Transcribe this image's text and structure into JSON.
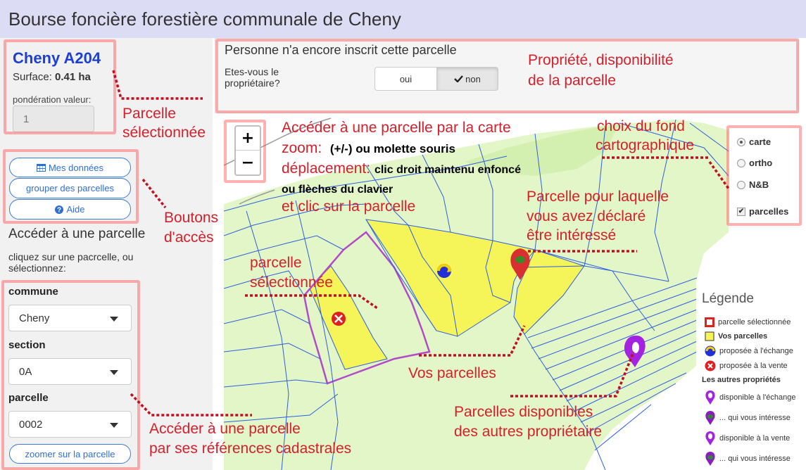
{
  "header": {
    "title": "Bourse foncière forestière communale de Cheny"
  },
  "parcel": {
    "name": "Cheny A204",
    "surface_label": "Surface: ",
    "surface_value": "0.41 ha",
    "ponderation_label": "pondération valeur:",
    "ponderation_value": "1"
  },
  "buttons": {
    "mes_donnees": "Mes données",
    "grouper": "grouper des parcelles",
    "aide": "Aide",
    "zoomer": "zoomer sur la parcelle"
  },
  "access": {
    "title": "Accéder à une parcelle",
    "hint": "cliquez sur une pacrcelle, ou sélectionnez:",
    "commune_label": "commune",
    "commune_value": "Cheny",
    "section_label": "section",
    "section_value": "0A",
    "parcelle_label": "parcelle",
    "parcelle_value": "0002"
  },
  "property": {
    "status": "Personne n'a encore inscrit cette parcelle",
    "question": "Etes-vous le propriétaire?",
    "oui": "oui",
    "non": "non"
  },
  "map": {
    "zoom_in": "+",
    "zoom_out": "−",
    "layers": {
      "carte": "carte",
      "ortho": "ortho",
      "nb": "N&B",
      "parcelles": "parcelles",
      "selected": "carte",
      "parcelles_checked": true
    },
    "legend": {
      "title": "Légende",
      "selected": "parcelle sélectionnée",
      "vos": "Vos parcelles",
      "echange": "proposée à l'échange",
      "vente": "proposée à la vente",
      "autres": "Les autres propriétés",
      "dispo_echange": "disponible à l'échange",
      "interesse1": "... qui vous intéresse",
      "dispo_vente": "disponible à la vente",
      "interesse2": "... qui vous intéresse"
    }
  },
  "annotations": {
    "propriete_1": "Propriété, disponibilité",
    "propriete_2": "de la parcelle",
    "parcelle_sel_1": "Parcelle",
    "parcelle_sel_2": "sélectionnée",
    "acceder_carte_1": "Accéder à une parcelle par la carte",
    "zoom_label": "zoom:",
    "zoom_text": "(+/-) ou molette souris",
    "deplacement_label": "déplacement:",
    "deplacement_text": "clic droit maintenu enfoncé",
    "fleches_text": "ou flèches du clavier",
    "clic_parcelle": "et clic sur la parcelle",
    "fond_1": "choix du fond",
    "fond_2": "cartographique",
    "interesse_1": "Parcelle pour laquelle",
    "interesse_2": "vous avez déclaré",
    "interesse_3": "être intéressé",
    "boutons_1": "Boutons",
    "boutons_2": "d'accès",
    "map_sel_1": "parcelle",
    "map_sel_2": "sélectionnée",
    "vos_parcelles": "Vos parcelles",
    "dispo_1": "Parcelles disponibles",
    "dispo_2": "des autres propriétaire",
    "cadastre_1": "Accéder à une parcelle",
    "cadastre_2": "par ses références cadastrales"
  },
  "colors": {
    "annotation_red": "#d4202a",
    "link_blue": "#1c3fd4",
    "parcel_yellow": "#f5f55a",
    "map_green": "#e2f6c6",
    "parcel_line": "#2c5fe0",
    "marker_purple": "#a323e0"
  }
}
